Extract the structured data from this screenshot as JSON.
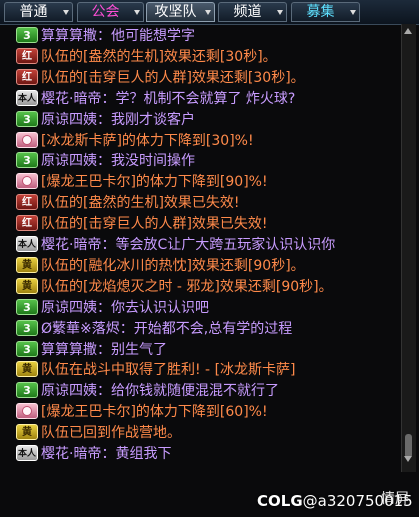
{
  "tabs": [
    {
      "label": "普通",
      "color": "#ffffff",
      "arrow": true
    },
    {
      "label": "公会",
      "color": "#ff4fd8",
      "arrow": true
    },
    {
      "label": "攻坚队",
      "color": "#ffffff",
      "arrow": true
    },
    {
      "label": "频道",
      "color": "#ffffff",
      "arrow": true
    },
    {
      "label": "募集",
      "color": "#5ee0ff",
      "arrow": true
    }
  ],
  "badge_texts": {
    "red": "红",
    "yellow": "黄",
    "gray": "本人",
    "green": "3"
  },
  "messages": [
    {
      "badge": "green",
      "text": "算算算撒：他可能想学字",
      "color": "#c89cff"
    },
    {
      "badge": "red",
      "text": "队伍的[盎然的生机]效果还剩[30秒]。",
      "color": "#ff8a4a"
    },
    {
      "badge": "red",
      "text": "队伍的[击穿巨人的人群]效果还剩[30秒]。",
      "color": "#ff8a4a"
    },
    {
      "badge": "gray",
      "text": "樱花·暗帝：学？机制不会就算了 炸火球?",
      "color": "#c89cff"
    },
    {
      "badge": "green",
      "text": "原谅四姨：我刚才谈客户",
      "color": "#c89cff"
    },
    {
      "badge": "pink",
      "text": "[冰龙斯卡萨]的体力下降到[30]%!",
      "color": "#ff8a4a"
    },
    {
      "badge": "green",
      "text": "原谅四姨：我没时间操作",
      "color": "#c89cff"
    },
    {
      "badge": "pink",
      "text": "[爆龙王巴卡尔]的体力下降到[90]%!",
      "color": "#ff8a4a"
    },
    {
      "badge": "red",
      "text": "队伍的[盎然的生机]效果已失效!",
      "color": "#ff8a4a"
    },
    {
      "badge": "red",
      "text": "队伍的[击穿巨人的人群]效果已失效!",
      "color": "#ff8a4a"
    },
    {
      "badge": "gray",
      "text": "樱花·暗帝：等会放C让广大跨五玩家认识认识你",
      "color": "#c89cff"
    },
    {
      "badge": "yellow",
      "text": "队伍的[融化冰川的热忱]效果还剩[90秒]。",
      "color": "#ff8a4a"
    },
    {
      "badge": "yellow",
      "text": "队伍的[龙焰熄灭之时 - 邪龙]效果还剩[90秒]。",
      "color": "#ff8a4a"
    },
    {
      "badge": "green",
      "text": "原谅四姨：你去认识认识吧",
      "color": "#c89cff"
    },
    {
      "badge": "green",
      "text": "Ø蘩華※落烬：开始都不会,总有学的过程",
      "color": "#c89cff"
    },
    {
      "badge": "green",
      "text": "算算算撒：别生气了",
      "color": "#c89cff"
    },
    {
      "badge": "yellow",
      "text": "队伍在战斗中取得了胜利! - [冰龙斯卡萨]",
      "color": "#ff8a4a"
    },
    {
      "badge": "green",
      "text": "原谅四姨：给你钱就随便混混不就行了",
      "color": "#c89cff"
    },
    {
      "badge": "pink",
      "text": "[爆龙王巴卡尔]的体力下降到[60]%!",
      "color": "#ff8a4a"
    },
    {
      "badge": "yellow",
      "text": "队伍已回到作战营地。",
      "color": "#ff8a4a"
    },
    {
      "badge": "gray",
      "text": "樱花·暗帝：黄组我下",
      "color": "#c89cff"
    }
  ],
  "footer": {
    "watermark_brand": "COLG",
    "watermark_user": "@a320750015",
    "lock_label": "情屏"
  }
}
